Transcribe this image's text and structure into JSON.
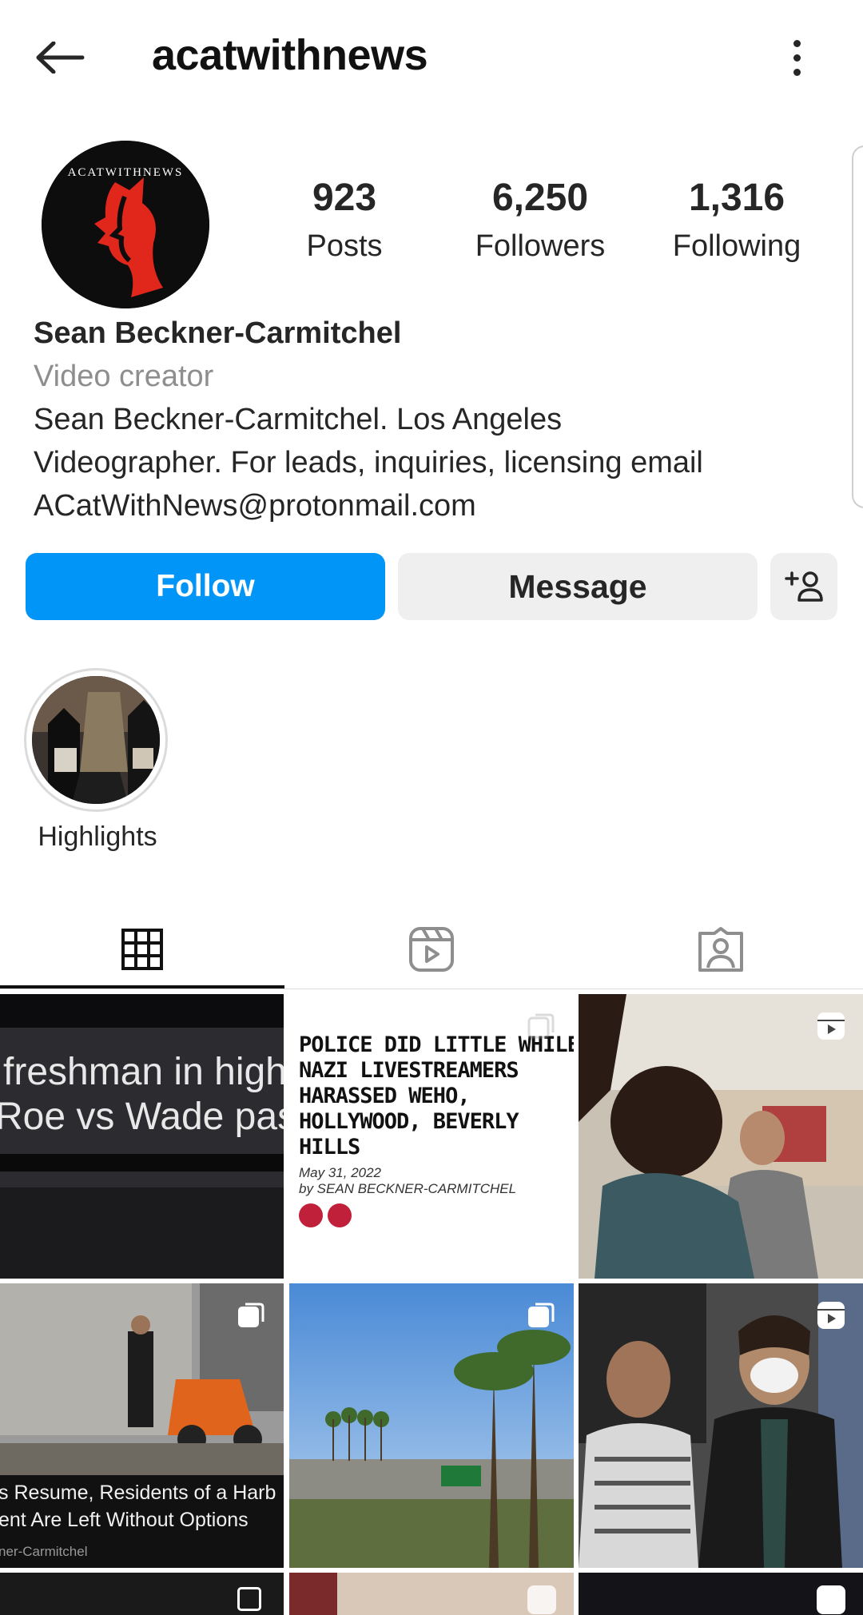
{
  "header": {
    "username": "acatwithnews"
  },
  "stats": [
    {
      "value": "923",
      "label": "Posts"
    },
    {
      "value": "6,250",
      "label": "Followers"
    },
    {
      "value": "1,316",
      "label": "Following"
    }
  ],
  "profile": {
    "name": "Sean Beckner-Carmitchel",
    "category": "Video creator",
    "bio_lines": [
      "Sean Beckner-Carmitchel. Los Angeles",
      "Videographer. For leads, inquiries, licensing email",
      "ACatWithNews@protonmail.com"
    ]
  },
  "actions": {
    "follow": "Follow",
    "message": "Message"
  },
  "highlights": [
    {
      "label": "Highlights"
    }
  ],
  "tabs": [
    {
      "icon": "grid-icon",
      "active": true
    },
    {
      "icon": "reels-icon",
      "active": false
    },
    {
      "icon": "tagged-icon",
      "active": false
    }
  ],
  "posts": [
    {
      "caption_lines": [
        "freshman in high",
        "Roe vs Wade pass"
      ],
      "badge": "none"
    },
    {
      "headline_lines": [
        "POLICE DID LITTLE WHILE",
        "NAZI LIVESTREAMERS",
        "HARASSED WEHO,",
        "HOLLYWOOD, BEVERLY",
        "HILLS"
      ],
      "date": "May 31, 2022",
      "byline": "by SEAN BECKNER-CARMITCHEL",
      "badge": "carousel-icon"
    },
    {
      "badge": "reel-icon"
    },
    {
      "caption_lines": [
        "s Resume, Residents of a Harb",
        "ent Are Left Without Options"
      ],
      "credit": "ner-Carmitchel",
      "badge": "carousel-icon"
    },
    {
      "badge": "carousel-icon"
    },
    {
      "badge": "reel-icon"
    }
  ],
  "colors": {
    "follow_blue": "#0095f6",
    "button_gray": "#efefef",
    "secondary_text": "#8e8e8e"
  }
}
